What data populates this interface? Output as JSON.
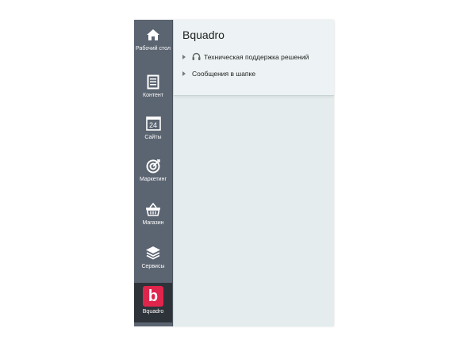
{
  "sidebar": {
    "items": [
      {
        "label": "Рабочий стол",
        "icon": "home-icon"
      },
      {
        "label": "Контент",
        "icon": "document-icon"
      },
      {
        "label": "Сайты",
        "icon": "calendar-icon",
        "icon_text": "24"
      },
      {
        "label": "Маркетинг",
        "icon": "target-icon"
      },
      {
        "label": "Магазин",
        "icon": "basket-icon"
      },
      {
        "label": "Сервисы",
        "icon": "layers-icon"
      },
      {
        "label": "Bquadro",
        "icon": "bquadro-logo-icon",
        "icon_text": "b",
        "active": true
      }
    ]
  },
  "main": {
    "title": "Bquadro",
    "rows": [
      {
        "label": "Техническая поддержка решений",
        "icon": "headset-icon"
      },
      {
        "label": "Сообщения в шапке"
      }
    ]
  },
  "colors": {
    "sidebar_bg": "#5b6471",
    "active_bg": "#2e333a",
    "brand_red": "#e0254d",
    "panel_bg": "#e4eced"
  }
}
